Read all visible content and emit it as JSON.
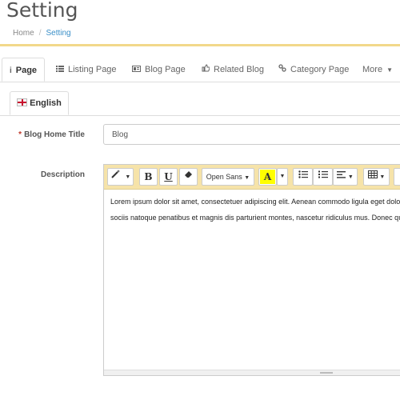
{
  "header": {
    "title": "Setting",
    "breadcrumb": [
      "Home",
      "Setting"
    ]
  },
  "tabs": [
    {
      "label": "Page",
      "icon": "info-icon",
      "active": true
    },
    {
      "label": "Listing Page",
      "icon": "list-icon"
    },
    {
      "label": "Blog Page",
      "icon": "card-icon"
    },
    {
      "label": "Related Blog",
      "icon": "thumbs-up-icon"
    },
    {
      "label": "Category Page",
      "icon": "link-icon"
    },
    {
      "label": "More",
      "icon": "caret-down-icon"
    }
  ],
  "language_tabs": [
    {
      "label": "English",
      "icon": "uk-flag-icon",
      "active": true
    }
  ],
  "form": {
    "blog_home_title": {
      "label": "Blog Home Title",
      "value": "Blog",
      "required": true
    },
    "description": {
      "label": "Description"
    }
  },
  "editor": {
    "font_name": "Open Sans",
    "toolbar_buttons": [
      "magic-wand",
      "bold",
      "underline",
      "eraser",
      "font-family",
      "font-color",
      "color-dropdown",
      "bullet-list",
      "numbered-list",
      "align",
      "table"
    ],
    "content_lines": [
      "Lorem ipsum dolor sit amet, consectetuer adipiscing elit. Aenean commodo ligula eget dolor.",
      "sociis natoque penatibus et magnis dis parturient montes, nascetur ridiculus mus. Donec quam"
    ],
    "toolbar_color": "#f6e3a9",
    "highlight_color": "#ffff00"
  }
}
